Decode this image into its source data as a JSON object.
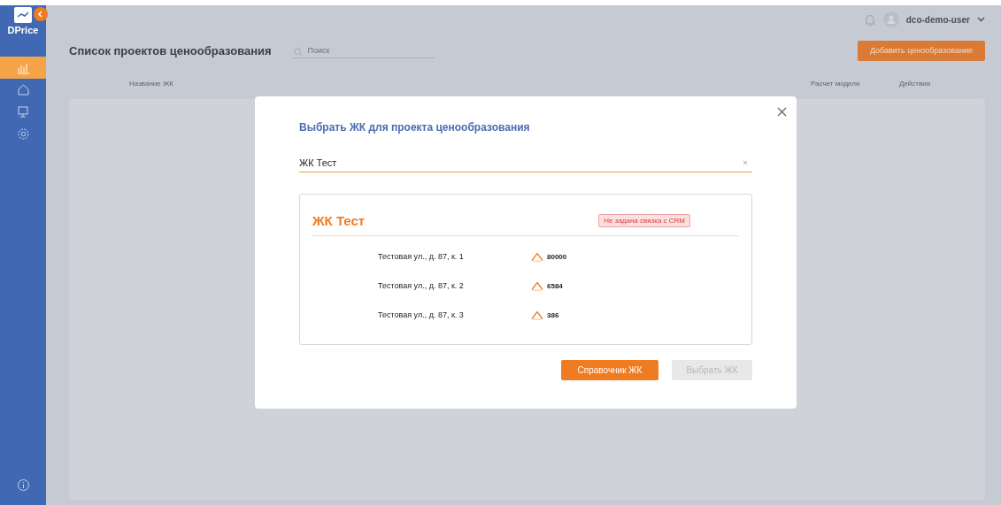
{
  "sidebar": {
    "logo": "DPrice",
    "collapsed": false,
    "items": [
      {
        "kind": "chart",
        "selected": true
      },
      {
        "kind": "home",
        "selected": false
      },
      {
        "kind": "monitor",
        "selected": false
      },
      {
        "kind": "gear",
        "selected": false
      }
    ]
  },
  "header": {
    "user": "dco-demo-user"
  },
  "page": {
    "title": "Список проектов ценообразования",
    "search": {
      "placeholder": "Поиск"
    },
    "add_button": "Добавить ценообразование"
  },
  "table": {
    "columns": [
      "Название ЖК",
      "Расчет модели",
      "Действия"
    ]
  },
  "modal": {
    "title": "Выбрать ЖК для проекта ценообразования",
    "field": {
      "value": "ЖК Тест"
    },
    "card": {
      "name": "ЖК Тест",
      "badge": "Не задана связка с CRM",
      "buildings": [
        {
          "address": "Тестовая ул., д. 87, к. 1",
          "count": "80000"
        },
        {
          "address": "Тестовая ул., д. 87,  к. 2",
          "count": "6584"
        },
        {
          "address": "Тестовая ул., д. 87,  к. 3",
          "count": "386"
        }
      ]
    },
    "buttons": [
      {
        "label": "Справочник ЖК",
        "disabled": false
      },
      {
        "label": "Выбрать ЖК",
        "disabled": true
      }
    ]
  }
}
